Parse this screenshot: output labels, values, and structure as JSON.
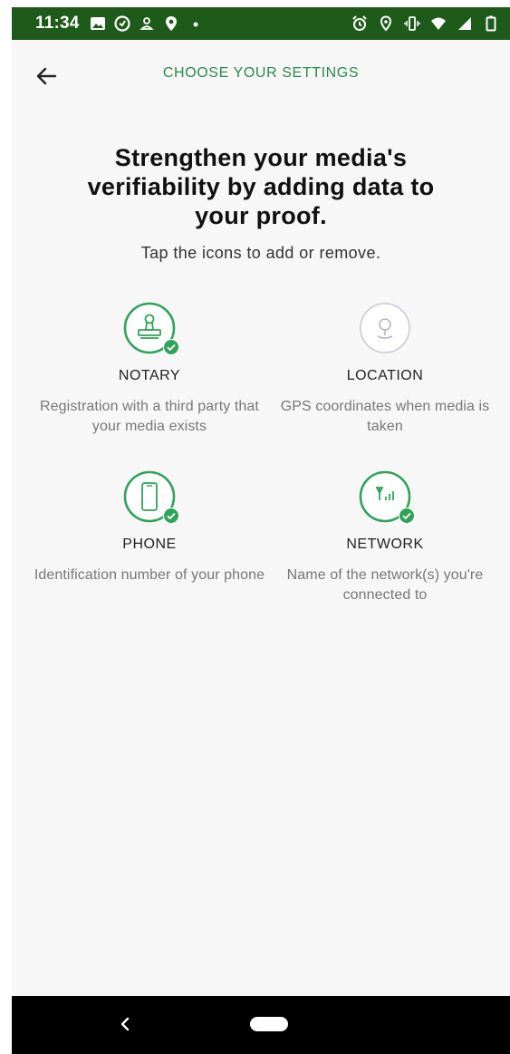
{
  "status_bar": {
    "time": "11:34",
    "icons_left": [
      "image-icon",
      "clock-in-circle-icon",
      "person-icon",
      "location-pin-icon",
      "dot-icon"
    ],
    "icons_right": [
      "alarm-icon",
      "location-outline-icon",
      "vibrate-icon",
      "wifi-icon",
      "cell-signal-icon",
      "battery-icon"
    ]
  },
  "header": {
    "title": "CHOOSE YOUR SETTINGS",
    "back_icon": "arrow-left-icon"
  },
  "headline": "Strengthen your media's verifiability by adding data to your proof.",
  "subline": "Tap the icons to add or remove.",
  "settings": [
    {
      "title": "NOTARY",
      "description": "Registration with a third party that your media exists",
      "selected": true,
      "icon": "stamp-icon"
    },
    {
      "title": "LOCATION",
      "description": "GPS coordinates when media is taken",
      "selected": false,
      "icon": "location-icon"
    },
    {
      "title": "PHONE",
      "description": "Identification number of your phone",
      "selected": true,
      "icon": "phone-icon"
    },
    {
      "title": "NETWORK",
      "description": "Name of the network(s) you're connected to",
      "selected": true,
      "icon": "network-signal-icon"
    }
  ],
  "colors": {
    "status_bar": "#1e5a1a",
    "accent": "#2a8a4a",
    "selected_ring": "#2fa35a",
    "unselected_ring": "#c9c9d6",
    "nav_bar": "#000000"
  }
}
